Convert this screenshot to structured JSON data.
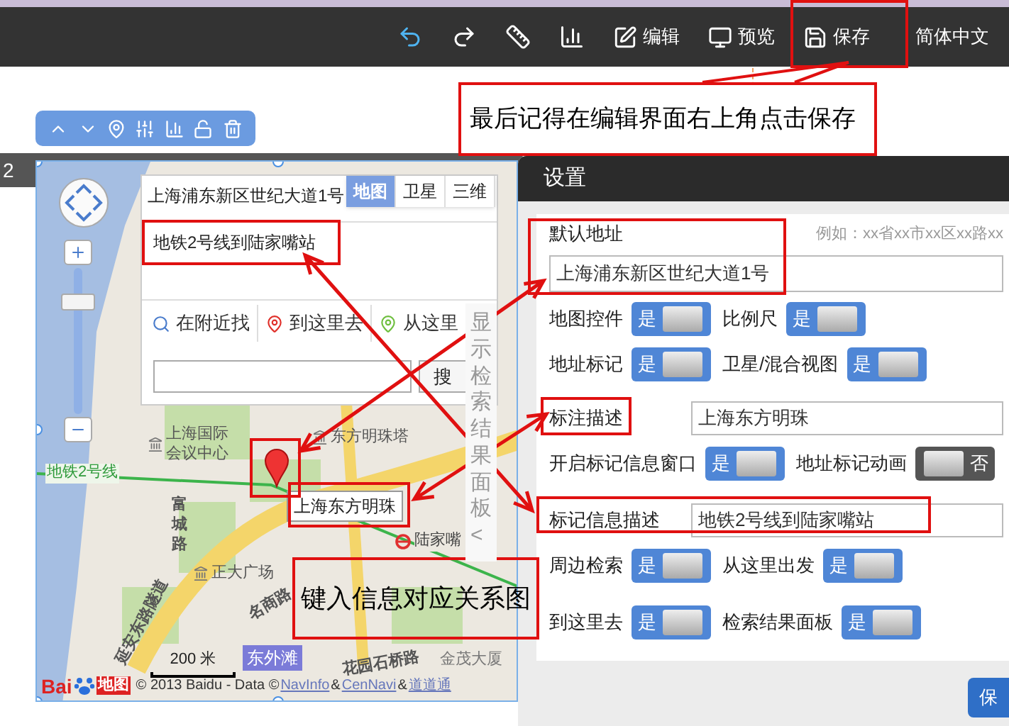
{
  "top_toolbar": {
    "actions": [
      {
        "kind": "edit",
        "label": "编辑"
      },
      {
        "kind": "preview",
        "label": "预览"
      },
      {
        "kind": "save",
        "label": "保存"
      }
    ],
    "language": "简体中文"
  },
  "annotations": {
    "save_note": "最后记得在编辑界面右上角点击保存",
    "mapping_note": "键入信息对应关系图"
  },
  "page_number": "2",
  "map": {
    "address": "上海浦东新区世纪大道1号",
    "map_types": [
      {
        "label": "地图",
        "selected": true
      },
      {
        "label": "卫星",
        "selected": false
      },
      {
        "label": "三维",
        "selected": false
      }
    ],
    "description": "地铁2号线到陆家嘴站",
    "search_tabs": [
      {
        "kind": "nearby",
        "label": "在附近找"
      },
      {
        "kind": "to",
        "label": "到这里去"
      },
      {
        "kind": "from",
        "label": "从这里"
      }
    ],
    "search_button": "搜",
    "results_panel": "显示检索结果面板<",
    "places": [
      {
        "kind": "poi",
        "text": "上海国际会议中心"
      },
      {
        "kind": "poi",
        "text": "东方明珠塔"
      },
      {
        "kind": "metro",
        "text": "地铁2号线"
      },
      {
        "kind": "road",
        "text": "富城路"
      },
      {
        "kind": "station",
        "text": "陆家嘴"
      },
      {
        "kind": "poi",
        "text": "正大广场"
      },
      {
        "kind": "road",
        "text": "名商路"
      },
      {
        "kind": "road",
        "text": "延安东路隧道"
      },
      {
        "kind": "plain",
        "text": "金茂大厦"
      },
      {
        "kind": "road",
        "text": "花园石桥路"
      }
    ],
    "marker_label": "上海东方明珠",
    "scale": "200 米",
    "district": "东外滩",
    "logo": {
      "text": "Bai",
      "product": "地图"
    },
    "copyright": "© 2013 Baidu - Data ©",
    "data_links": [
      "NavInfo",
      "CenNavi",
      "道道通"
    ],
    "link_separator": "&"
  },
  "settings": {
    "title": "设置",
    "rows": [
      {
        "kind": "address",
        "label": "默认地址",
        "hint": "例如：xx省xx市xx区xx路xx",
        "value": "上海浦东新区世纪大道1号"
      },
      {
        "kind": "toggles",
        "toggles": [
          {
            "label": "地图控件",
            "on": true,
            "text": "是"
          },
          {
            "label": "比例尺",
            "on": true,
            "text": "是"
          }
        ]
      },
      {
        "kind": "toggles",
        "toggles": [
          {
            "label": "地址标记",
            "on": true,
            "text": "是"
          },
          {
            "label": "卫星/混合视图",
            "on": true,
            "text": "是"
          }
        ]
      },
      {
        "kind": "field",
        "label": "标注描述",
        "value": "上海东方明珠"
      },
      {
        "kind": "toggles",
        "toggles": [
          {
            "label": "开启标记信息窗口",
            "on": true,
            "text": "是"
          },
          {
            "label": "地址标记动画",
            "on": false,
            "text": "否"
          }
        ]
      },
      {
        "kind": "field",
        "label": "标记信息描述",
        "value": "地铁2号线到陆家嘴站"
      },
      {
        "kind": "toggles",
        "toggles": [
          {
            "label": "周边检索",
            "on": true,
            "text": "是"
          },
          {
            "label": "从这里出发",
            "on": true,
            "text": "是"
          }
        ]
      },
      {
        "kind": "toggles",
        "toggles": [
          {
            "label": "到这里去",
            "on": true,
            "text": "是"
          },
          {
            "label": "检索结果面板",
            "on": true,
            "text": "是"
          }
        ]
      }
    ],
    "save_button": "保"
  }
}
